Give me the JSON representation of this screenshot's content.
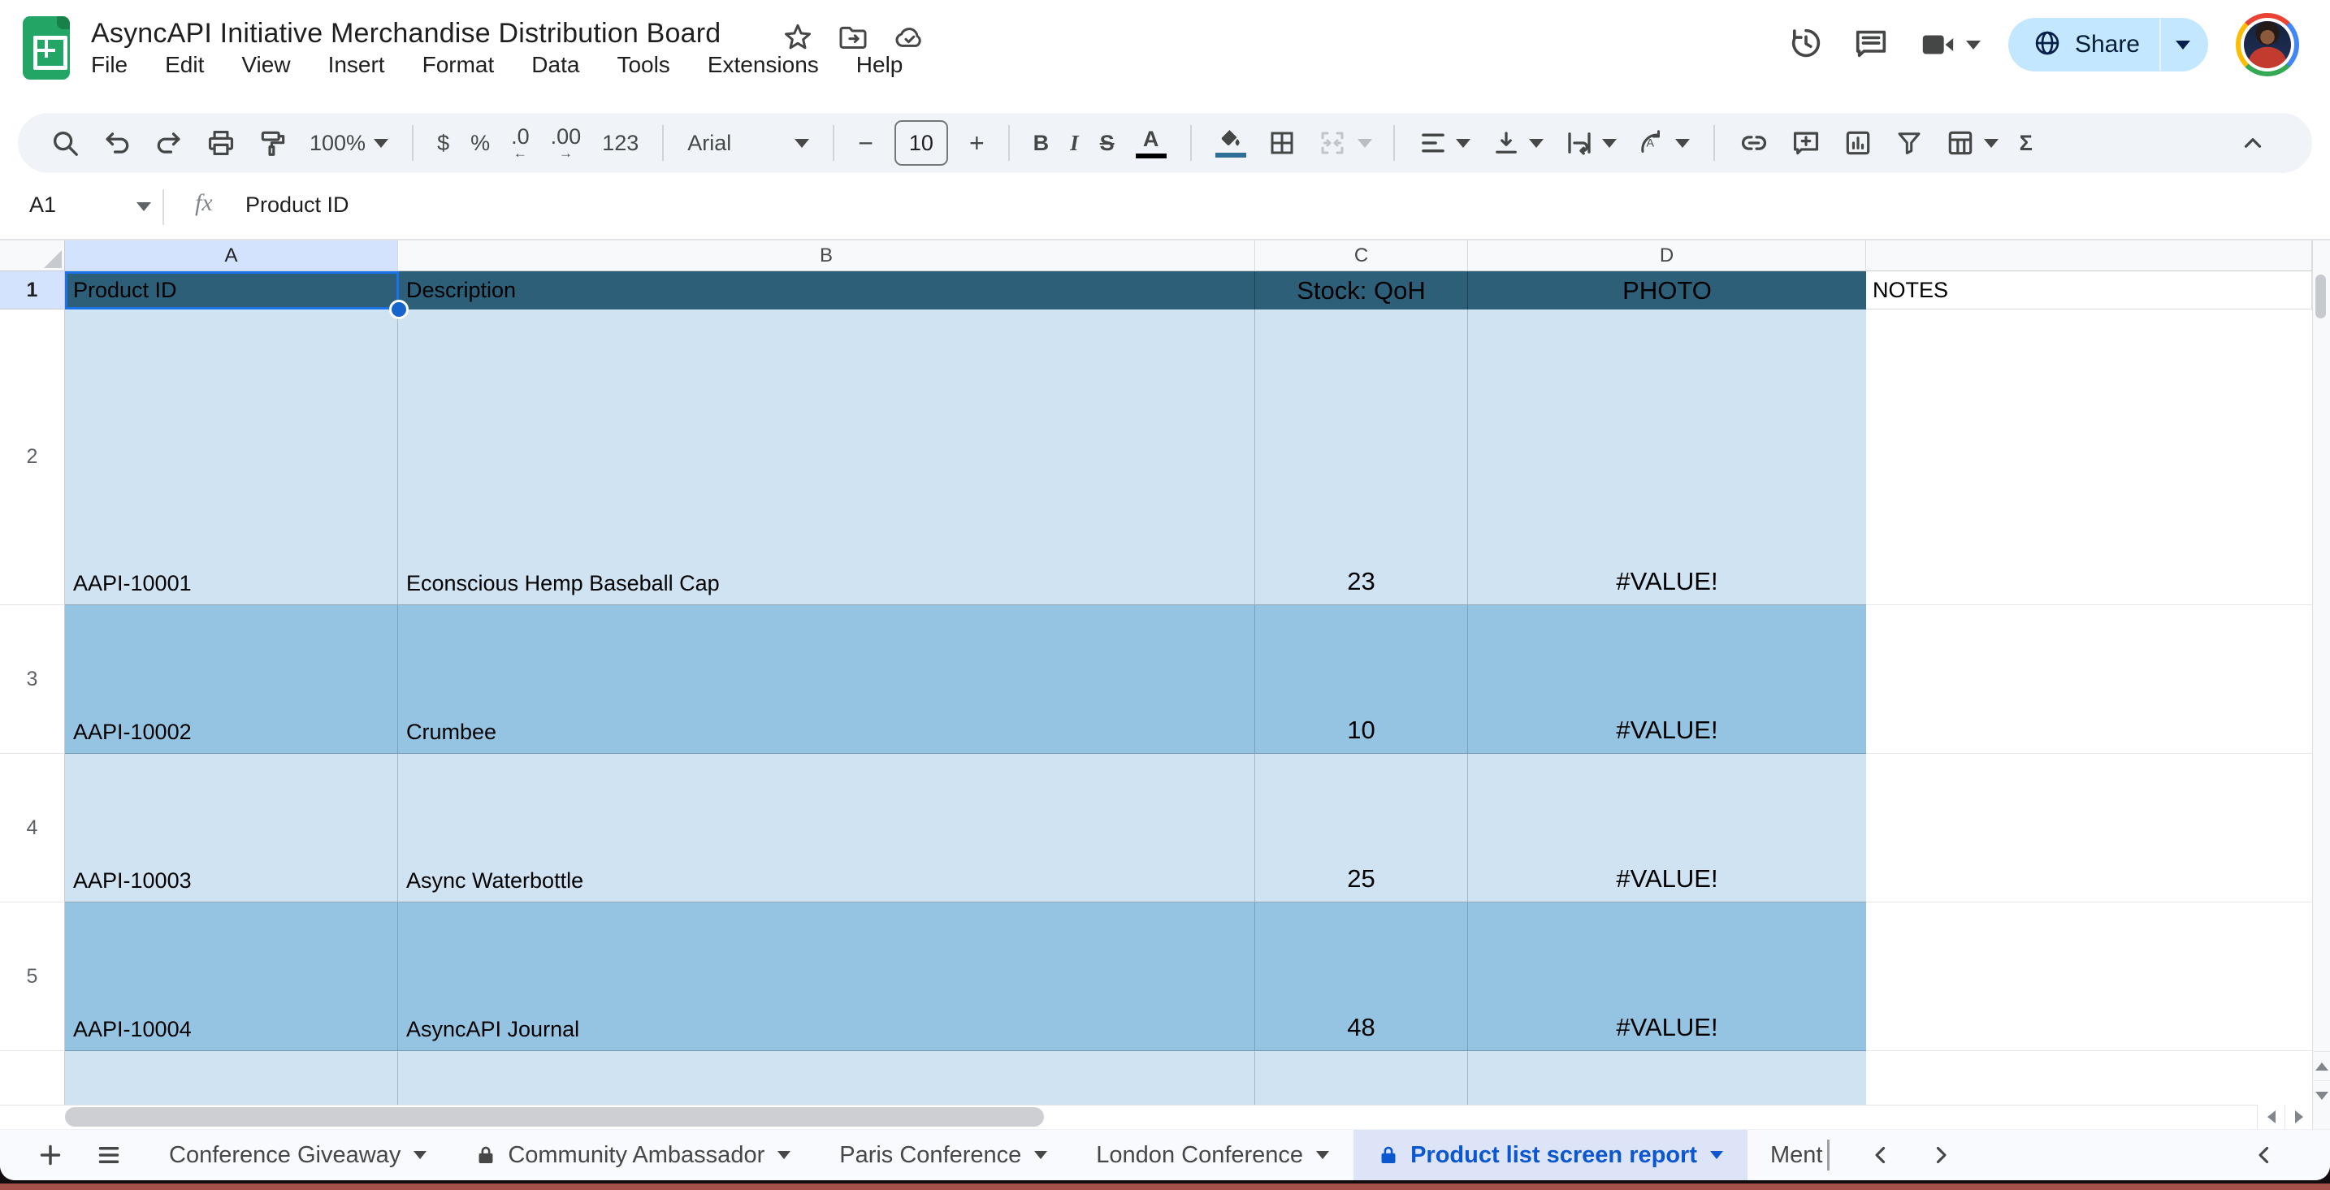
{
  "colors": {
    "header_fill": "#2d5f78",
    "row_light": "#cfe3f3",
    "row_dark": "#95c4e3",
    "selection_accent": "#1a73e8",
    "active_tab_text": "#0b57d0",
    "share_button_bg": "#c2e7ff",
    "fill_color_swatch": "#2d6f97"
  },
  "icons": {
    "logo": "sheets-green-grid",
    "title_row": [
      "star-icon",
      "move-folder-icon",
      "cloud-check-icon"
    ],
    "top_right": [
      "version-history-icon",
      "comments-icon",
      "video-call-icon"
    ],
    "share": "globe-icon",
    "toolbar": [
      "search-icon",
      "undo-icon",
      "redo-icon",
      "print-icon",
      "paint-format-icon",
      "borders-icon",
      "merge-cells-icon",
      "horizontal-align-icon",
      "vertical-align-icon",
      "text-wrap-icon",
      "text-rotation-icon",
      "insert-link-icon",
      "insert-comment-icon",
      "insert-chart-icon",
      "filter-icon",
      "table-views-icon",
      "collapse-toolbar-icon"
    ],
    "tabbar": [
      "add-sheet-icon",
      "all-sheets-icon",
      "lock-icon",
      "prev-tabs-icon",
      "next-tabs-icon",
      "show-side-panel-icon"
    ]
  },
  "titlebar": {
    "title": "AsyncAPI Initiative Merchandise Distribution Board",
    "menus": [
      "File",
      "Edit",
      "View",
      "Insert",
      "Format",
      "Data",
      "Tools",
      "Extensions",
      "Help"
    ],
    "share_label": "Share"
  },
  "toolbar": {
    "zoom_value": "100%",
    "currency": "$",
    "percent": "%",
    "decrease_decimal": ".0",
    "increase_decimal": ".00",
    "number_format": "123",
    "font_family": "Arial",
    "decrease_font": "−",
    "font_size": "10",
    "increase_font": "+",
    "bold": "B",
    "italic": "I",
    "strikethrough": "S",
    "text_color": "A",
    "functions": "Σ"
  },
  "formula_bar": {
    "cell_ref": "A1",
    "fx_label": "fx",
    "content": "Product ID"
  },
  "grid": {
    "col_letters": [
      "A",
      "B",
      "C",
      "D"
    ],
    "row_numbers": [
      "1",
      "2",
      "3",
      "4",
      "5"
    ],
    "header_row": {
      "a": "Product ID",
      "b": "Description",
      "c": "Stock: QoH",
      "d": "PHOTO",
      "e": "NOTES"
    },
    "rows": [
      {
        "id": "AAPI-10001",
        "desc": "Econscious Hemp Baseball Cap",
        "qoh": "23",
        "photo": "#VALUE!"
      },
      {
        "id": "AAPI-10002",
        "desc": "Crumbee",
        "qoh": "10",
        "photo": "#VALUE!"
      },
      {
        "id": "AAPI-10003",
        "desc": "Async Waterbottle",
        "qoh": "25",
        "photo": "#VALUE!"
      },
      {
        "id": "AAPI-10004",
        "desc": "AsyncAPI Journal",
        "qoh": "48",
        "photo": "#VALUE!"
      }
    ]
  },
  "tabs": {
    "items": [
      {
        "label": "Conference Giveaway",
        "locked": false,
        "active": false
      },
      {
        "label": "Community Ambassador",
        "locked": true,
        "active": false
      },
      {
        "label": "Paris Conference",
        "locked": false,
        "active": false
      },
      {
        "label": "London Conference",
        "locked": false,
        "active": false
      },
      {
        "label": "Product list screen report",
        "locked": true,
        "active": true
      }
    ],
    "overflow_label": "Ment"
  }
}
